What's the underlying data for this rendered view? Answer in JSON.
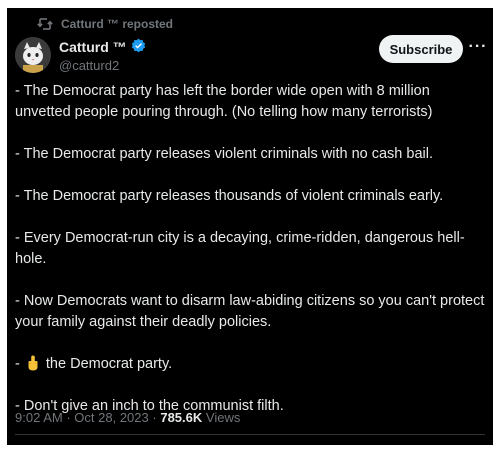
{
  "repost": {
    "icon": "repost-icon",
    "text": "Catturd ™ reposted"
  },
  "author": {
    "name": "Catturd ™",
    "handle": "@catturd2",
    "verified_icon": "verified-badge-icon",
    "verified_color": "#1d9bf0"
  },
  "actions": {
    "subscribe_label": "Subscribe",
    "more_label": "···"
  },
  "post": {
    "paragraphs": [
      "- The Democrat party has left the border wide open with 8 million unvetted people pouring through. (No telling how many terrorists)",
      "- The Democrat party releases violent criminals with no cash bail.",
      "- The Democrat party releases thousands of violent criminals early.",
      "- Every Democrat-run city is a decaying, crime-ridden, dangerous hell-hole.",
      "- Now Democrats want to disarm law-abiding citizens so you can't protect your family against their deadly policies."
    ],
    "emoji_line": {
      "prefix": "-",
      "emoji": "middle-finger-emoji",
      "text": "the Democrat party."
    },
    "last_line": "-  Don't give an inch to the communist filth."
  },
  "meta": {
    "time": "9:02 AM",
    "separator": "·",
    "date": "Oct 28, 2023",
    "views_count": "785.6K",
    "views_label": "Views"
  },
  "colors": {
    "background": "#000000",
    "text": "#e7e9ea",
    "muted": "#71767b",
    "button_bg": "#eff3f4",
    "divider": "#2f3336"
  }
}
